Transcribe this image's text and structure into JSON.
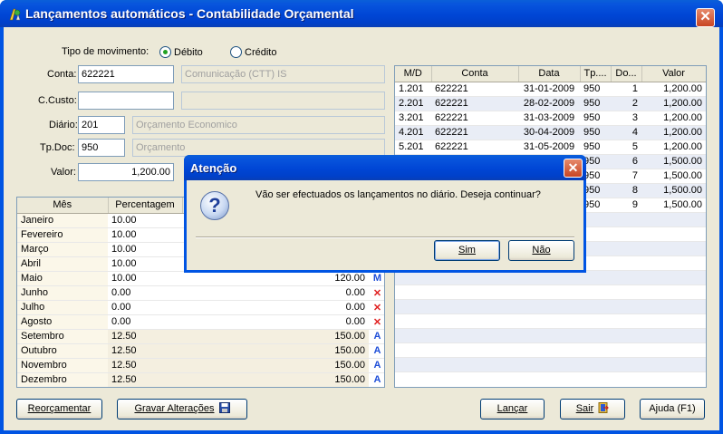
{
  "window": {
    "title": "Lançamentos automáticos - Contabilidade Orçamental",
    "close_glyph": "✕"
  },
  "form": {
    "tipo_label": "Tipo de movimento:",
    "tipo_options": [
      {
        "label": "Débito",
        "selected": true
      },
      {
        "label": "Crédito",
        "selected": false
      }
    ],
    "conta_label": "Conta:",
    "conta_value": "622221",
    "conta_desc": "Comunicação (CTT) IS",
    "ccusto_label": "C.Custo:",
    "ccusto_value": "",
    "ccusto_desc": "",
    "diario_label": "Diário:",
    "diario_value": "201",
    "diario_desc": "Orçamento Economico",
    "tpdoc_label": "Tp.Doc:",
    "tpdoc_value": "950",
    "tpdoc_desc": "Orçamento",
    "valor_label": "Valor:",
    "valor_value": "1,200.00"
  },
  "months_grid": {
    "headers": [
      "Mês",
      "Percentagem",
      "",
      ""
    ],
    "rows": [
      {
        "mes": "Janeiro",
        "pct": "10.00",
        "valor": "",
        "flag": ""
      },
      {
        "mes": "Fevereiro",
        "pct": "10.00",
        "valor": "",
        "flag": ""
      },
      {
        "mes": "Março",
        "pct": "10.00",
        "valor": "",
        "flag": ""
      },
      {
        "mes": "Abril",
        "pct": "10.00",
        "valor": "",
        "flag": ""
      },
      {
        "mes": "Maio",
        "pct": "10.00",
        "valor": "120.00",
        "flag": "M"
      },
      {
        "mes": "Junho",
        "pct": "0.00",
        "valor": "0.00",
        "flag": "✕"
      },
      {
        "mes": "Julho",
        "pct": "0.00",
        "valor": "0.00",
        "flag": "✕"
      },
      {
        "mes": "Agosto",
        "pct": "0.00",
        "valor": "0.00",
        "flag": "✕"
      },
      {
        "mes": "Setembro",
        "pct": "12.50",
        "valor": "150.00",
        "flag": "A"
      },
      {
        "mes": "Outubro",
        "pct": "12.50",
        "valor": "150.00",
        "flag": "A"
      },
      {
        "mes": "Novembro",
        "pct": "12.50",
        "valor": "150.00",
        "flag": "A"
      },
      {
        "mes": "Dezembro",
        "pct": "12.50",
        "valor": "150.00",
        "flag": "A"
      }
    ]
  },
  "entries_grid": {
    "headers": [
      "M/D",
      "Conta",
      "Data",
      "Tp....",
      "Do...",
      "Valor"
    ],
    "rows": [
      {
        "md": "1.201",
        "conta": "622221",
        "data": "31-01-2009",
        "tp": "950",
        "do": "1",
        "valor": "1,200.00"
      },
      {
        "md": "2.201",
        "conta": "622221",
        "data": "28-02-2009",
        "tp": "950",
        "do": "2",
        "valor": "1,200.00"
      },
      {
        "md": "3.201",
        "conta": "622221",
        "data": "31-03-2009",
        "tp": "950",
        "do": "3",
        "valor": "1,200.00"
      },
      {
        "md": "4.201",
        "conta": "622221",
        "data": "30-04-2009",
        "tp": "950",
        "do": "4",
        "valor": "1,200.00"
      },
      {
        "md": "5.201",
        "conta": "622221",
        "data": "31-05-2009",
        "tp": "950",
        "do": "5",
        "valor": "1,200.00"
      },
      {
        "md": "",
        "conta": "",
        "data": "",
        "tp": "950",
        "do": "6",
        "valor": "1,500.00"
      },
      {
        "md": "",
        "conta": "",
        "data": "",
        "tp": "950",
        "do": "7",
        "valor": "1,500.00"
      },
      {
        "md": "",
        "conta": "",
        "data": "",
        "tp": "950",
        "do": "8",
        "valor": "1,500.00"
      },
      {
        "md": "",
        "conta": "",
        "data": "",
        "tp": "950",
        "do": "9",
        "valor": "1,500.00"
      }
    ]
  },
  "buttons": {
    "reorcamentar": "Reorçamentar",
    "gravar": "Gravar Alterações",
    "lancar": "Lançar",
    "sair": "Sair",
    "ajuda": "Ajuda (F1)"
  },
  "dialog": {
    "title": "Atenção",
    "message": "Vão ser efectuados os lançamentos no diário. Deseja continuar?",
    "icon_glyph": "?",
    "yes": "Sim",
    "no": "Não",
    "close_glyph": "✕"
  },
  "colors": {
    "titlebar": "#0054e3",
    "face": "#ece9d8",
    "flag_blue": "#1e4ed8",
    "flag_red": "#e02020"
  }
}
